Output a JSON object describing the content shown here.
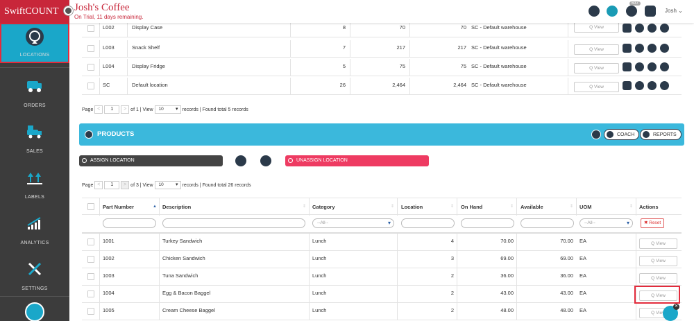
{
  "app": {
    "brand": "SwiftCOUNT",
    "business_name": "Josh's Coffee",
    "trial_text": "On Trial, 11 days remaining.",
    "user": "Josh ⌄",
    "badge": "637"
  },
  "sidebar": {
    "items": [
      {
        "label": "LOCATIONS",
        "icon": "locations-icon"
      },
      {
        "label": "ORDERS",
        "icon": "truck-icon"
      },
      {
        "label": "SALES",
        "icon": "sales-truck-icon"
      },
      {
        "label": "LABELS",
        "icon": "labels-icon"
      },
      {
        "label": "ANALYTICS",
        "icon": "analytics-icon"
      },
      {
        "label": "SETTINGS",
        "icon": "settings-icon"
      }
    ]
  },
  "locations_table": {
    "rows": [
      {
        "code": "L002",
        "name": "Display Case",
        "count": "8",
        "qty": "70",
        "qty2": "70",
        "warehouse": "SC - Default warehouse",
        "view": "Q View"
      },
      {
        "code": "L003",
        "name": "Snack Shelf",
        "count": "7",
        "qty": "217",
        "qty2": "217",
        "warehouse": "SC - Default warehouse",
        "view": "Q View"
      },
      {
        "code": "L004",
        "name": "Display Fridge",
        "count": "5",
        "qty": "75",
        "qty2": "75",
        "warehouse": "SC - Default warehouse",
        "view": "Q View"
      },
      {
        "code": "SC",
        "name": "Default location",
        "count": "26",
        "qty": "2,464",
        "qty2": "2,464",
        "warehouse": "SC - Default warehouse",
        "view": "Q View"
      }
    ]
  },
  "locations_pager": {
    "page_label": "Page",
    "prev": "<",
    "page": "1",
    "next": ">",
    "of": "of 1 | View",
    "per_page": "10",
    "suffix": "records | Found total 5 records"
  },
  "products": {
    "title": "PRODUCTS",
    "coach_label": "COACH",
    "reports_label": "REPORTS",
    "assign_label": "ASSIGN LOCATION",
    "unassign_label": "UNASSIGN LOCATION",
    "pager": {
      "page_label": "Page",
      "prev": "<",
      "page": "1",
      "next": ">",
      "of": "of 3 | View",
      "per_page": "10",
      "suffix": "records | Found total 26 records"
    },
    "columns": {
      "part_number": "Part Number",
      "description": "Description",
      "category": "Category",
      "location": "Location",
      "on_hand": "On Hand",
      "available": "Available",
      "uom": "UOM",
      "actions": "Actions"
    },
    "filters": {
      "category": "--All--",
      "uom": "--All--",
      "reset": "✖ Reset"
    },
    "rows": [
      {
        "part": "1001",
        "desc": "Turkey Sandwich",
        "category": "Lunch",
        "location": "4",
        "on_hand": "70.00",
        "available": "70.00",
        "uom": "EA",
        "view": "Q View"
      },
      {
        "part": "1002",
        "desc": "Chicken Sandwich",
        "category": "Lunch",
        "location": "3",
        "on_hand": "69.00",
        "available": "69.00",
        "uom": "EA",
        "view": "Q View"
      },
      {
        "part": "1003",
        "desc": "Tuna Sandwich",
        "category": "Lunch",
        "location": "2",
        "on_hand": "36.00",
        "available": "36.00",
        "uom": "EA",
        "view": "Q View"
      },
      {
        "part": "1004",
        "desc": "Egg & Bacon Baggel",
        "category": "Lunch",
        "location": "2",
        "on_hand": "43.00",
        "available": "43.00",
        "uom": "EA",
        "view": "Q View"
      },
      {
        "part": "1005",
        "desc": "Cream Cheese Baggel",
        "category": "Lunch",
        "location": "2",
        "on_hand": "48.00",
        "available": "48.00",
        "uom": "EA",
        "view": "Q View"
      }
    ]
  },
  "colors": {
    "brand": "#c8263a",
    "sidebar": "#3c3c3c",
    "active": "#1aa7c9",
    "panel": "#3bb8dc",
    "assign": "#444444",
    "unassign": "#ee3b62",
    "highlight": "#e32b3c"
  }
}
